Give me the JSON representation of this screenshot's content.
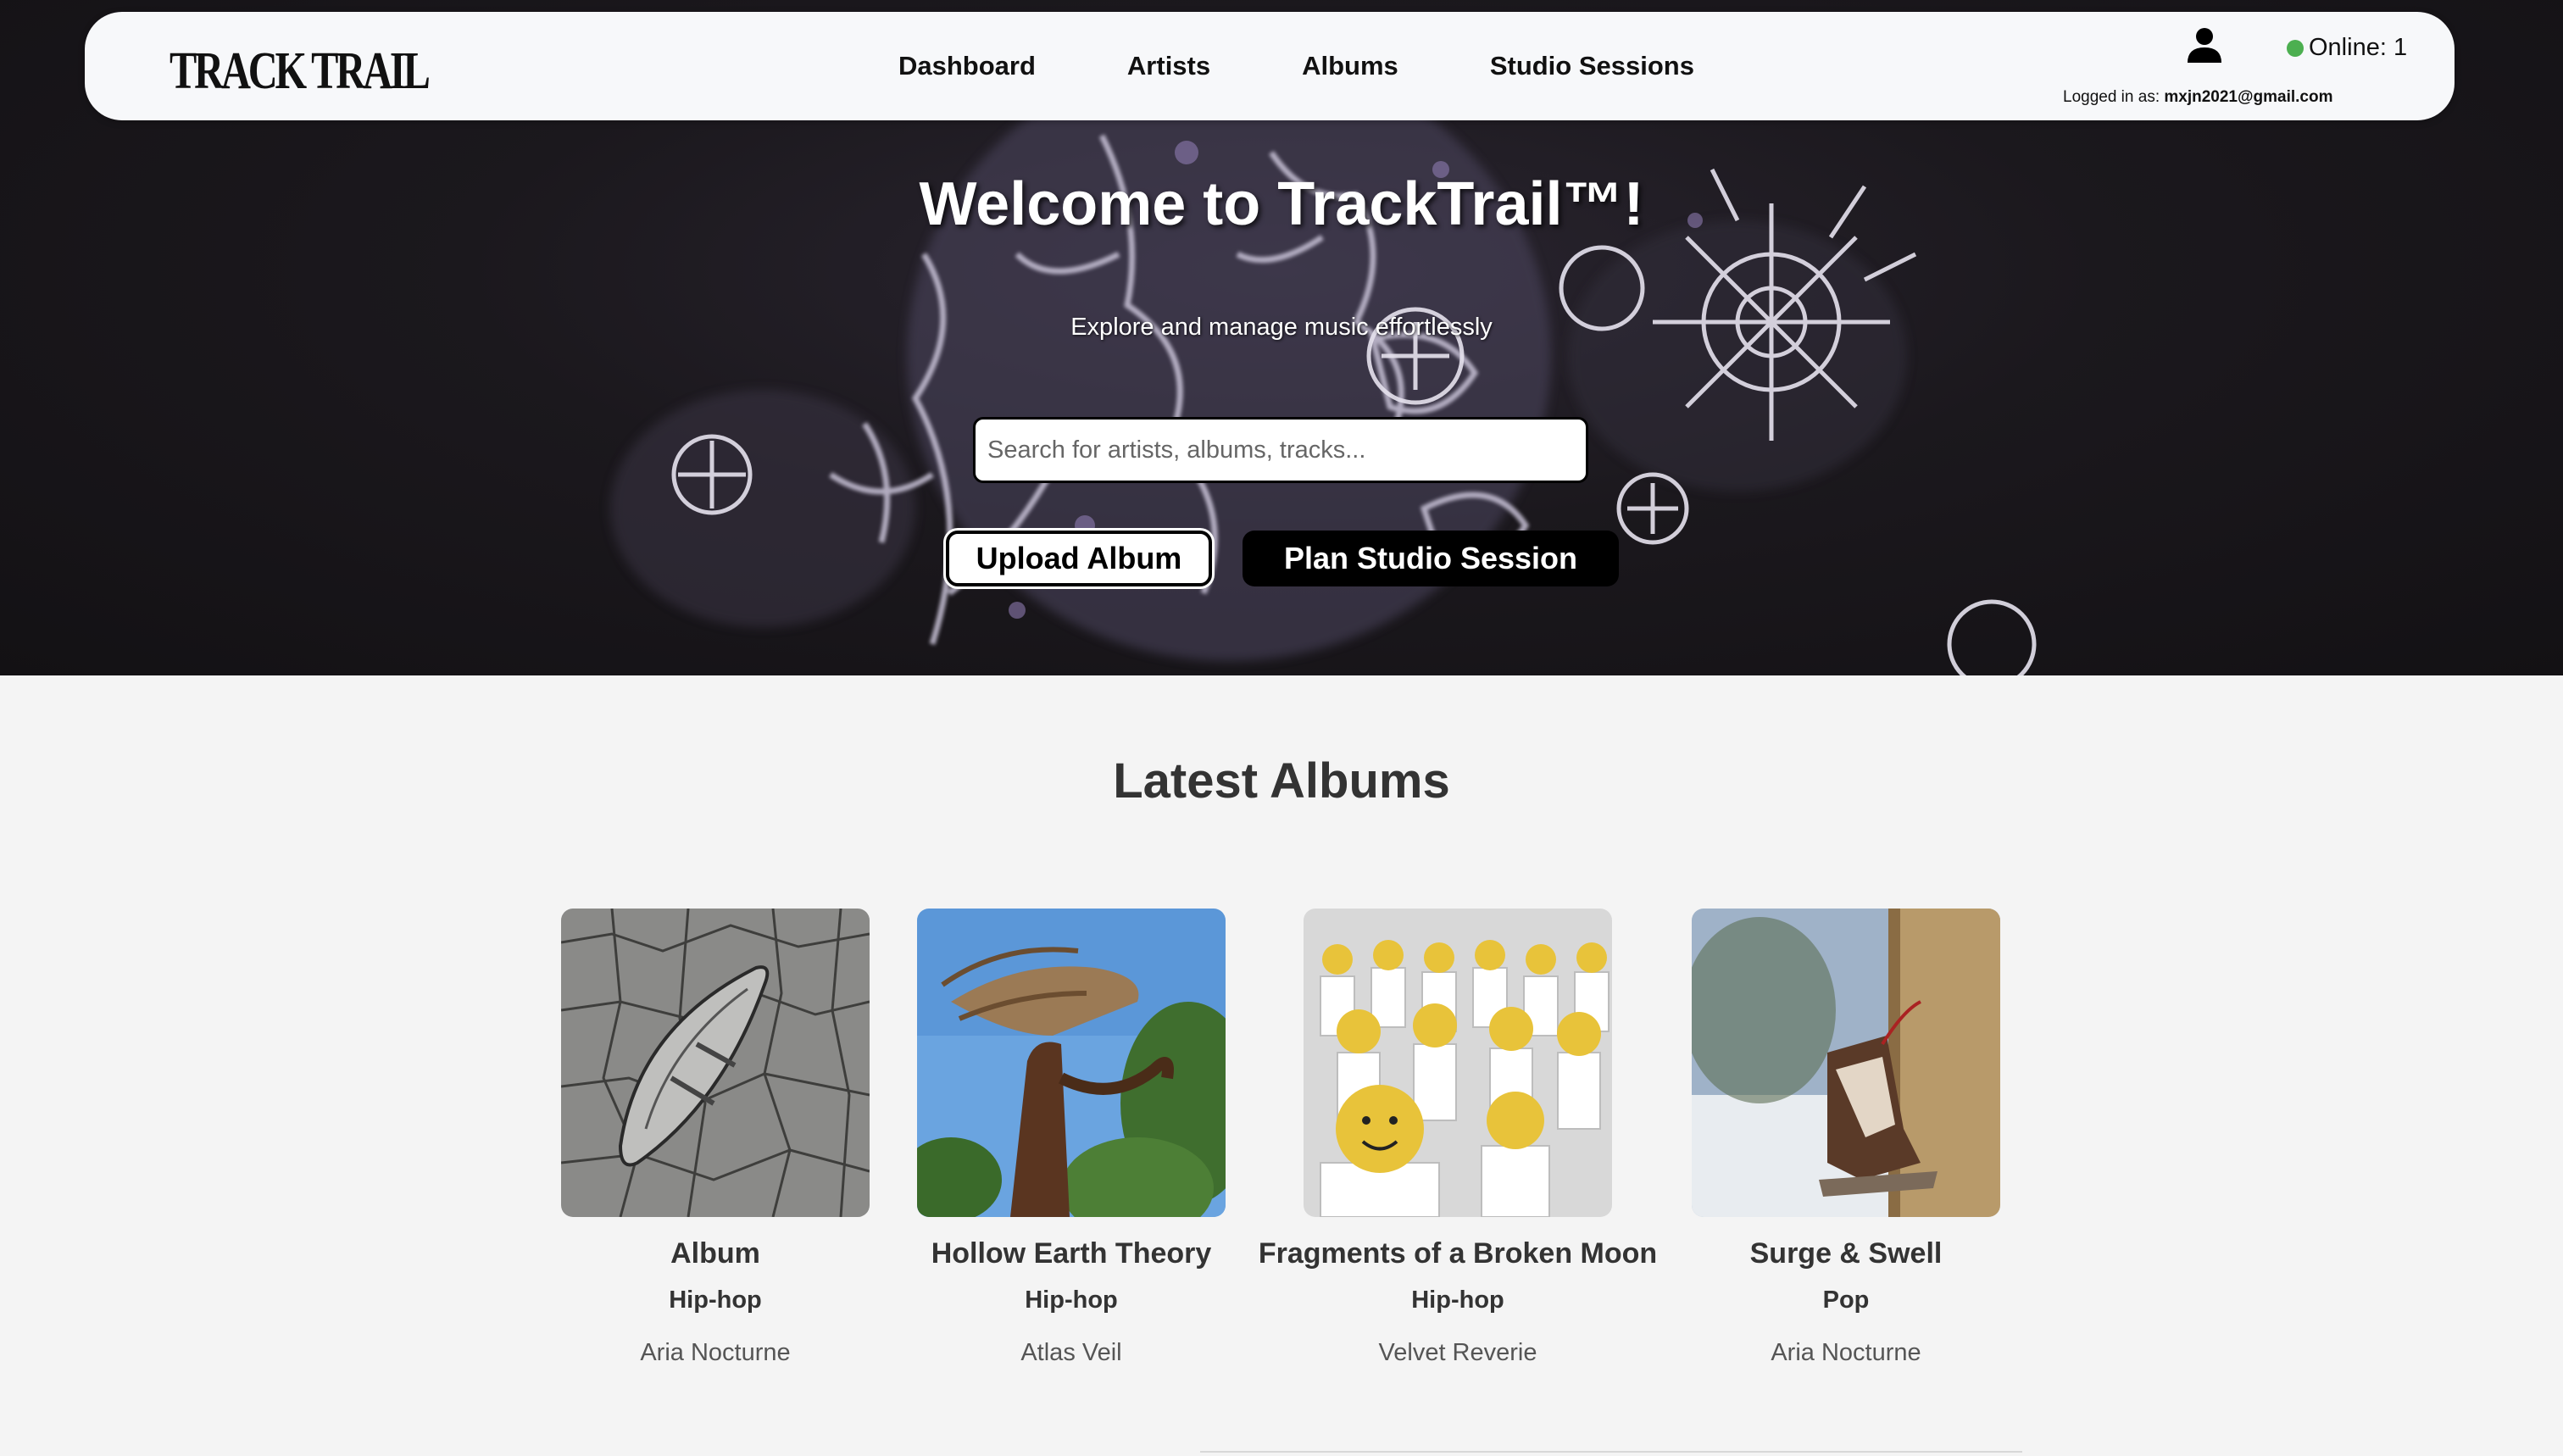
{
  "nav": {
    "logo": "TRACK TRAIL",
    "links": [
      "Dashboard",
      "Artists",
      "Albums",
      "Studio Sessions"
    ],
    "online_label": "Online: 1",
    "logged_in_prefix": "Logged in as: ",
    "user_email": "mxjn2021@gmail.com"
  },
  "hero": {
    "title": "Welcome to TrackTrail™!",
    "subtitle": "Explore and manage music effortlessly",
    "search_placeholder": "Search for artists, albums, tracks...",
    "upload_label": "Upload Album",
    "plan_label": "Plan Studio Session"
  },
  "latest": {
    "heading": "Latest Albums",
    "albums": [
      {
        "title": "Album",
        "genre": "Hip-hop",
        "artist": "Aria Nocturne"
      },
      {
        "title": "Hollow Earth Theory",
        "genre": "Hip-hop",
        "artist": "Atlas Veil"
      },
      {
        "title": "Fragments of a Broken Moon",
        "genre": "Hip-hop",
        "artist": "Velvet Reverie"
      },
      {
        "title": "Surge & Swell",
        "genre": "Pop",
        "artist": "Aria Nocturne"
      }
    ]
  },
  "colors": {
    "online_dot": "#4caf50",
    "hero_bg": "#1b181d",
    "nav_bg": "#f7f8fa",
    "page_bg": "#f4f4f4"
  }
}
